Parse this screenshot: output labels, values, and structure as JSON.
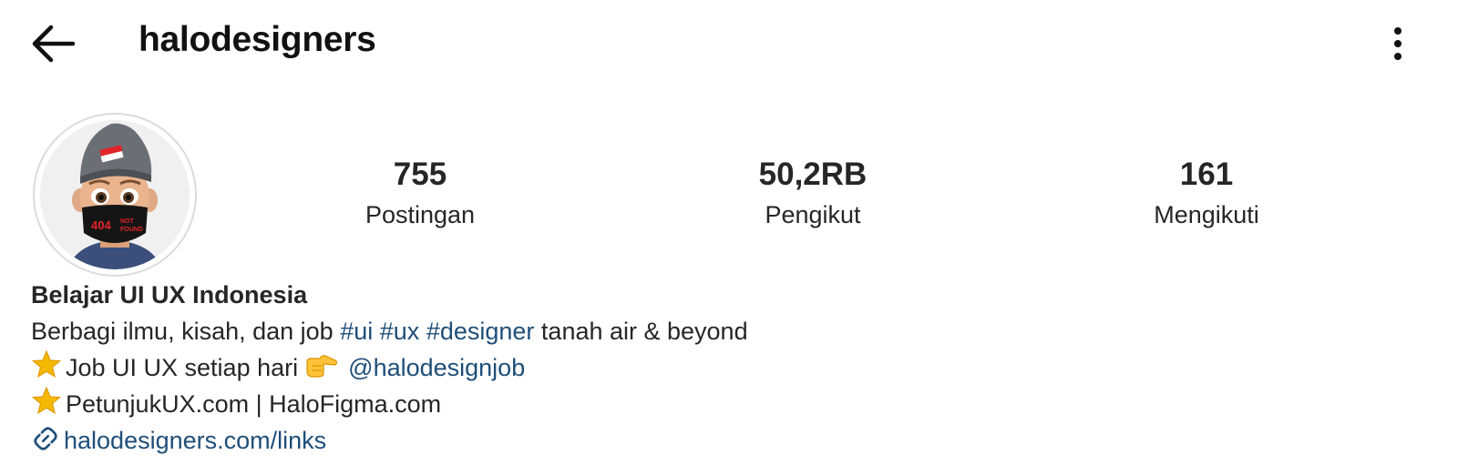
{
  "header": {
    "back_icon": "arrow-left-icon",
    "username": "halodesigners",
    "more_icon": "vertical-ellipsis-icon"
  },
  "profile": {
    "avatar_icon": "memoji-avatar-icon",
    "avatar_mask_text_1": "404",
    "avatar_mask_text_2": "NOT",
    "avatar_mask_text_3": "FOUND"
  },
  "stats": [
    {
      "value": "755",
      "label": "Postingan"
    },
    {
      "value": "50,2RB",
      "label": "Pengikut"
    },
    {
      "value": "161",
      "label": "Mengikuti"
    }
  ],
  "bio": {
    "name": "Belajar UI UX Indonesia",
    "line1_text": "Berbagi ilmu, kisah, dan job",
    "hashtags": [
      "#ui",
      "#ux",
      "#designer"
    ],
    "line1_suffix": "tanah air & beyond",
    "line2_text": "Job UI UX setiap hari",
    "line2_mention": "@halodesignjob",
    "line3_text": "PetunjukUX.com | HaloFigma.com",
    "link": "halodesigners.com/links"
  },
  "colors": {
    "link": "#1f4e79",
    "text": "#262626",
    "star": "#f5b800"
  }
}
